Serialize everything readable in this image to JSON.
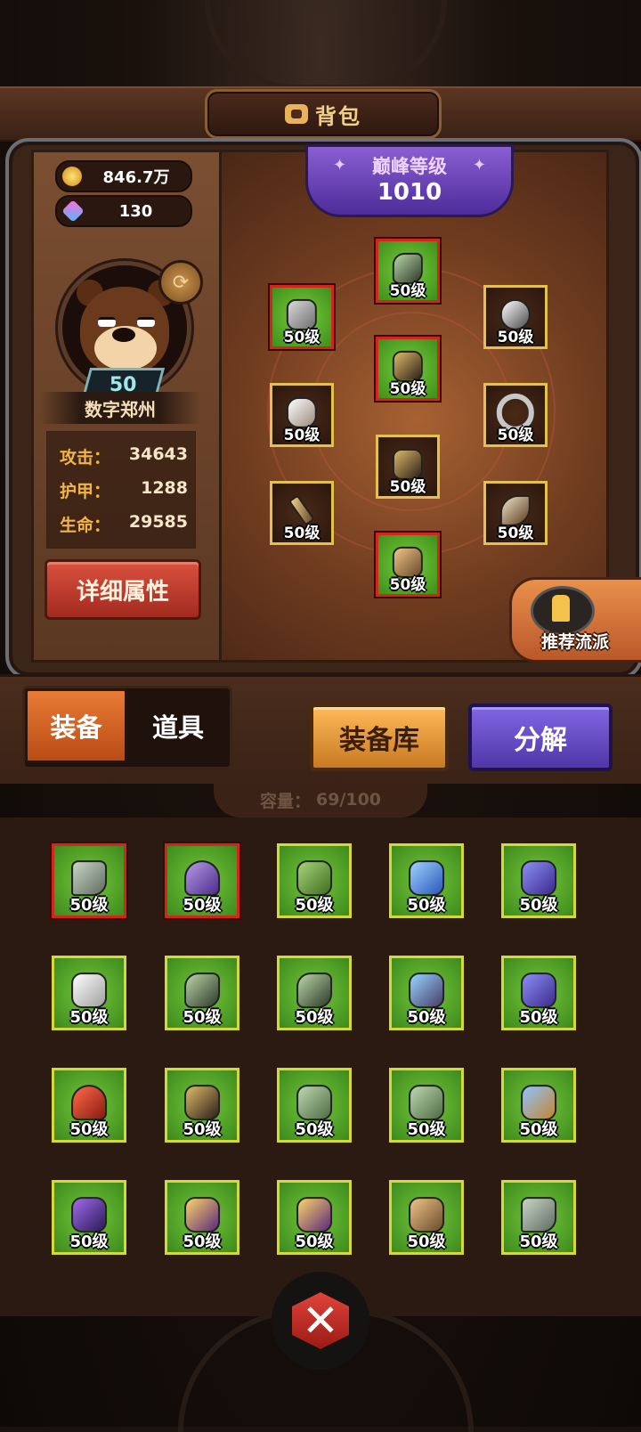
{
  "title": "背包",
  "currency": {
    "gold": "846.7万",
    "gems": "130"
  },
  "hero": {
    "level": "50",
    "name": "数字郑州",
    "stats": [
      {
        "label": "攻击：",
        "value": "34643"
      },
      {
        "label": "护甲：",
        "value": "1288"
      },
      {
        "label": "生命：",
        "value": "29585"
      }
    ],
    "detail_button": "详细属性"
  },
  "peak": {
    "label": "巅峰等级",
    "value": "1010"
  },
  "equipped": {
    "head": "50级",
    "helmet": "50级",
    "chest": "50级",
    "necklace": "50级",
    "gloves": "50级",
    "ring": "50级",
    "legs": "50级",
    "weapon": "50级",
    "horn": "50级",
    "boots": "50级"
  },
  "recommend_label": "推荐流派",
  "tabs": {
    "equip": "装备",
    "items": "道具"
  },
  "buttons": {
    "library": "装备库",
    "split": "分解"
  },
  "capacity": {
    "label": "容量：",
    "value": "69/100"
  },
  "bag_items": [
    {
      "name": "boots",
      "level": "50级",
      "red": true
    },
    {
      "name": "helmet",
      "level": "50级",
      "red": true
    },
    {
      "name": "armor",
      "level": "50级"
    },
    {
      "name": "blue-armor",
      "level": "50级"
    },
    {
      "name": "purple-armor",
      "level": "50级"
    },
    {
      "name": "white-armor",
      "level": "50级"
    },
    {
      "name": "beast-helm",
      "level": "50级"
    },
    {
      "name": "beast-helm",
      "level": "50级"
    },
    {
      "name": "claw-helm",
      "level": "50级"
    },
    {
      "name": "antler-helm",
      "level": "50级"
    },
    {
      "name": "plume-helm",
      "level": "50级"
    },
    {
      "name": "dark-pants",
      "level": "50级"
    },
    {
      "name": "green-pants",
      "level": "50级"
    },
    {
      "name": "green-pants",
      "level": "50级"
    },
    {
      "name": "blue-pants",
      "level": "50级"
    },
    {
      "name": "purple-pants",
      "level": "50级"
    },
    {
      "name": "gold-pants",
      "level": "50级"
    },
    {
      "name": "gold-pants",
      "level": "50级"
    },
    {
      "name": "bronze-boots",
      "level": "50级"
    },
    {
      "name": "grey-boots",
      "level": "50级"
    }
  ]
}
